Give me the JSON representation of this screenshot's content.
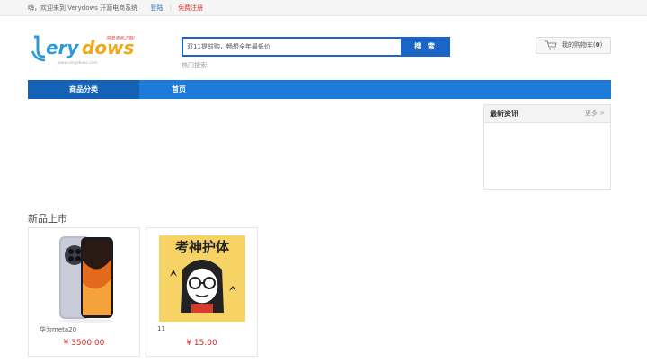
{
  "topbar": {
    "welcome": "嗨，欢迎来到 Verydows 开源电商系统",
    "login": "登陆",
    "register": "免费注册"
  },
  "logo": {
    "text": "Verydows",
    "slogan": "简单电商之路!",
    "url": "www.verydows.com"
  },
  "search": {
    "placeholder": "双11提前购，畅想全年最低价",
    "button": "搜 索",
    "hot_label": "热门搜索:"
  },
  "cart": {
    "label": "我的购物车(",
    "count": "0",
    "close": ")"
  },
  "nav": {
    "category": "商品分类",
    "home": "首页"
  },
  "news": {
    "title": "最新资讯",
    "more": "更多 >"
  },
  "section": {
    "title": "新品上市"
  },
  "products": [
    {
      "name": "华为meta20",
      "price": "¥ 3500.00"
    },
    {
      "name": "11",
      "price": "¥ 15.00"
    }
  ],
  "product_image_text": "考神护体",
  "colors": {
    "nav": "#1e7ad9",
    "nav_active": "#1461b5",
    "price": "#d8241e",
    "search_btn": "#1a65c7"
  }
}
